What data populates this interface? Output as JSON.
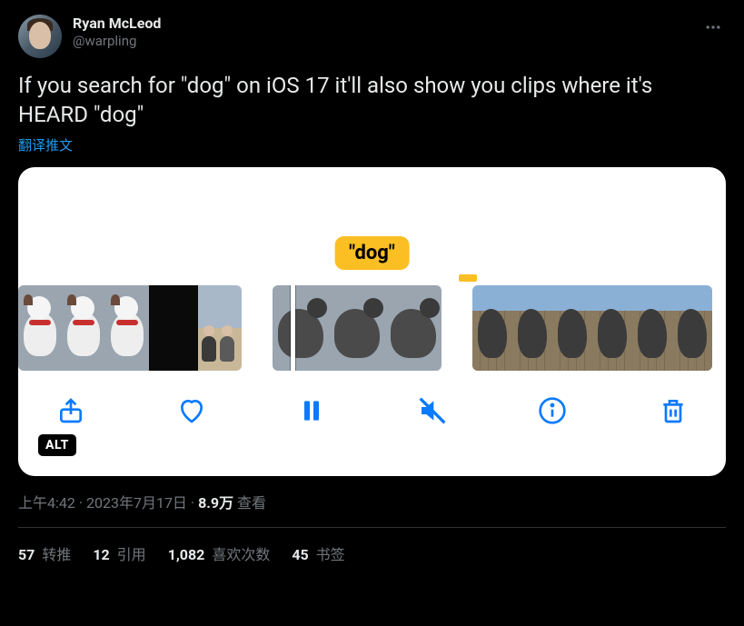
{
  "author": {
    "display_name": "Ryan McLeod",
    "handle": "@warpling"
  },
  "tweet_text": "If you search for \"dog\" on iOS 17 it'll also show you clips where it's HEARD \"dog\"",
  "translate_label": "翻译推文",
  "media": {
    "caption_bubble": "\"dog\"",
    "alt_badge": "ALT",
    "toolbar_icons": {
      "share": "share-icon",
      "like": "heart-icon",
      "pause": "pause-icon",
      "mute": "mute-icon",
      "info": "info-icon",
      "trash": "trash-icon"
    }
  },
  "meta": {
    "time": "上午4:42",
    "date": "2023年7月17日",
    "sep": " · ",
    "views_num": "8.9万",
    "views_label": " 查看"
  },
  "stats": {
    "retweets_num": "57",
    "retweets_label": " 转推",
    "quotes_num": "12",
    "quotes_label": " 引用",
    "likes_num": "1,082",
    "likes_label": " 喜欢次数",
    "bookmarks_num": "45",
    "bookmarks_label": " 书签"
  }
}
